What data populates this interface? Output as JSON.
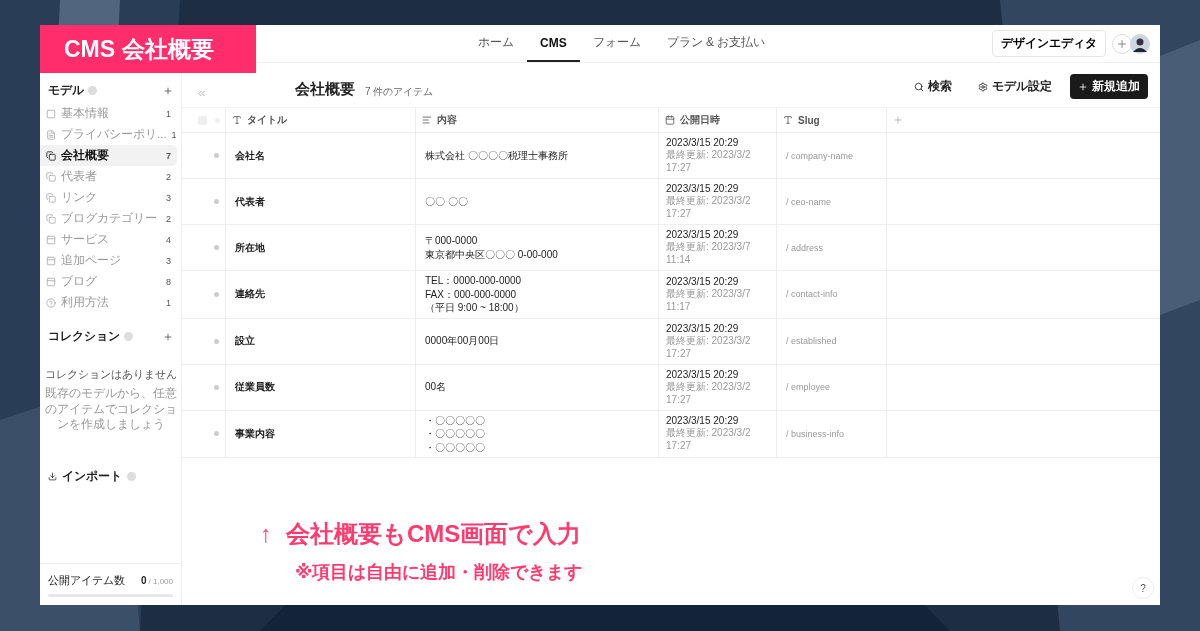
{
  "banner": {
    "title": "CMS 会社概要"
  },
  "nav": {
    "tabs": [
      {
        "label": "ホーム",
        "selected": false
      },
      {
        "label": "CMS",
        "selected": true
      },
      {
        "label": "フォーム",
        "selected": false
      },
      {
        "label": "プラン & お支払い",
        "selected": false
      }
    ],
    "design_editor": "デザインエディタ"
  },
  "sidebar": {
    "models_heading": "モデル",
    "models": [
      {
        "label": "基本情報",
        "count": "1",
        "selected": false
      },
      {
        "label": "プライバシーポリ...",
        "count": "1",
        "selected": false
      },
      {
        "label": "会社概要",
        "count": "7",
        "selected": true
      },
      {
        "label": "代表者",
        "count": "2",
        "selected": false
      },
      {
        "label": "リンク",
        "count": "3",
        "selected": false
      },
      {
        "label": "ブログカテゴリー",
        "count": "2",
        "selected": false
      },
      {
        "label": "サービス",
        "count": "4",
        "selected": false
      },
      {
        "label": "追加ページ",
        "count": "3",
        "selected": false
      },
      {
        "label": "ブログ",
        "count": "8",
        "selected": false
      },
      {
        "label": "利用方法",
        "count": "1",
        "selected": false
      }
    ],
    "collections_heading": "コレクション",
    "collections_empty_title": "コレクションはありません",
    "collections_empty_text": "既存のモデルから、任意のアイテムでコレクションを作成しましょう",
    "import": "インポート",
    "published_label": "公開アイテム数",
    "published_count": "0",
    "published_limit": "/ 1,000",
    "level": 0
  },
  "main": {
    "title": "会社概要",
    "count": "7 件のアイテム",
    "actions": [
      {
        "label": "検索",
        "kind": "search"
      },
      {
        "label": "モデル設定",
        "kind": "settings"
      },
      {
        "label": "新規追加",
        "kind": "add"
      }
    ]
  },
  "table": {
    "select_all": {
      "checked": false
    },
    "columns": [
      {
        "label": "タイトル",
        "kind": "text"
      },
      {
        "label": "内容",
        "kind": "richtext"
      },
      {
        "label": "公開日時",
        "kind": "date"
      },
      {
        "label": "Slug",
        "kind": "text"
      }
    ],
    "rows": [
      {
        "title": "会社名",
        "content": [
          "株式会社 〇〇〇〇税理士事務所"
        ],
        "published": "2023/3/15 20:29",
        "updated": "最終更新: 2023/3/2 17:27",
        "slug": "/ company-name"
      },
      {
        "title": "代表者",
        "content": [
          "〇〇 〇〇"
        ],
        "published": "2023/3/15 20:29",
        "updated": "最終更新: 2023/3/2 17:27",
        "slug": "/ ceo-name"
      },
      {
        "title": "所在地",
        "content": [
          "〒000-0000",
          "東京都中央区〇〇〇 0-00-000"
        ],
        "published": "2023/3/15 20:29",
        "updated": "最終更新: 2023/3/7 11:14",
        "slug": "/ address"
      },
      {
        "title": "連絡先",
        "content": [
          "TEL：0000-000-0000",
          "FAX：000-000-0000",
          "（平日 9:00 ~ 18:00）"
        ],
        "published": "2023/3/15 20:29",
        "updated": "最終更新: 2023/3/7 11:17",
        "slug": "/ contact-info"
      },
      {
        "title": "設立",
        "content": [
          "0000年00月00日"
        ],
        "published": "2023/3/15 20:29",
        "updated": "最終更新: 2023/3/2 17:27",
        "slug": "/ established"
      },
      {
        "title": "従業員数",
        "content": [
          "00名"
        ],
        "published": "2023/3/15 20:29",
        "updated": "最終更新: 2023/3/2 17:27",
        "slug": "/ employee"
      },
      {
        "title": "事業内容",
        "content": [
          "・〇〇〇〇〇",
          "・〇〇〇〇〇",
          "・〇〇〇〇〇"
        ],
        "published": "2023/3/15 20:29",
        "updated": "最終更新: 2023/3/2 17:27",
        "slug": "/ business-info"
      }
    ]
  },
  "annotation": {
    "arrow": "↑",
    "headline": "会社概要もCMS画面で入力",
    "note": "※項目は自由に追加・削除できます"
  },
  "help": "?"
}
